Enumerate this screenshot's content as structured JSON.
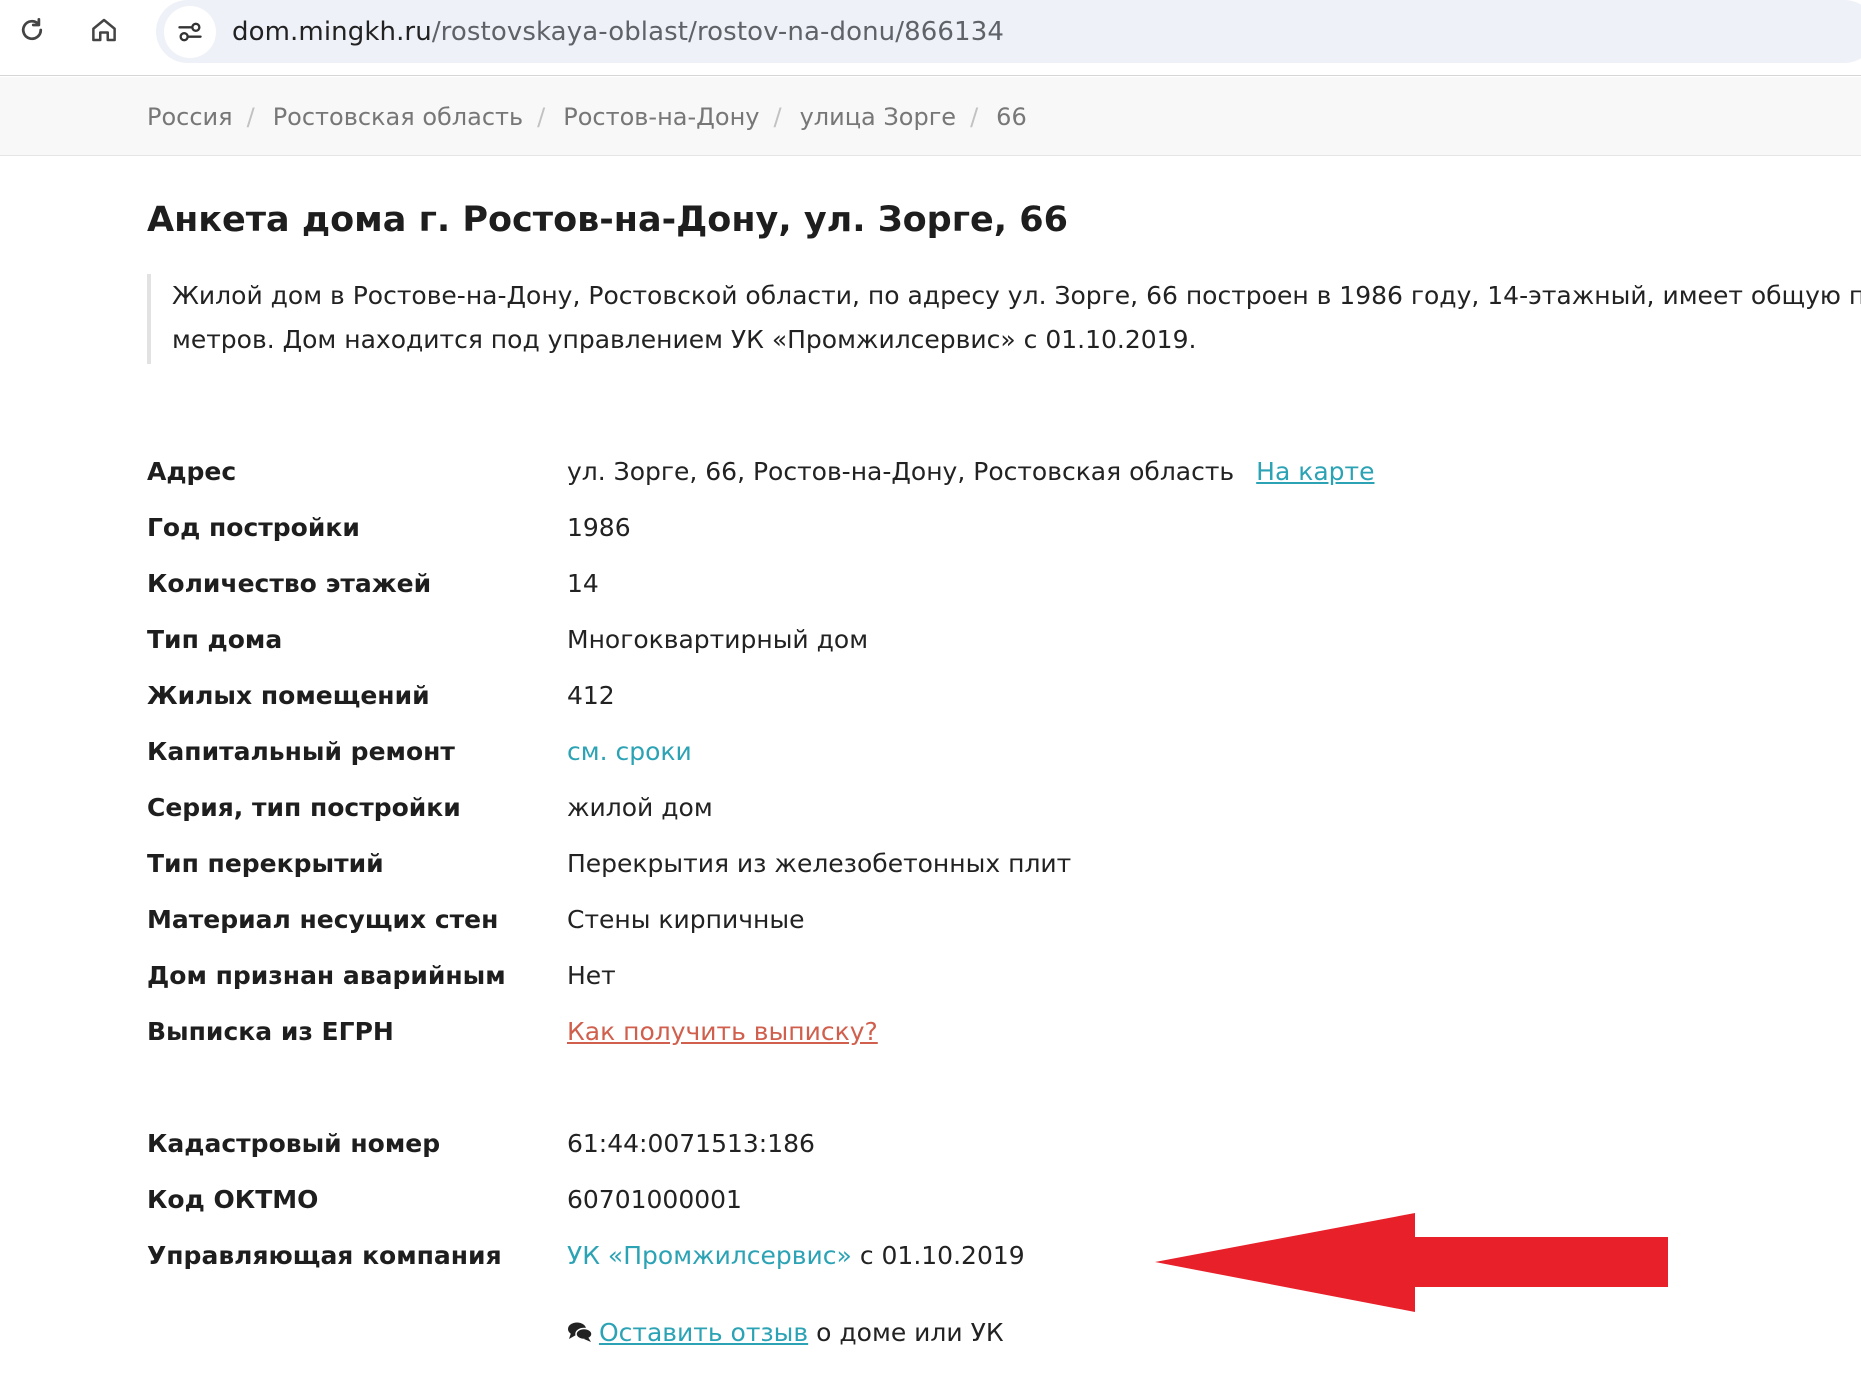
{
  "browser": {
    "url_host": "dom.mingkh.ru",
    "url_path": "/rostovskaya-oblast/rostov-na-donu/866134"
  },
  "breadcrumb": [
    {
      "label": "Россия"
    },
    {
      "label": "Ростовская область"
    },
    {
      "label": "Ростов-на-Дону"
    },
    {
      "label": "улица Зорге"
    },
    {
      "label": "66"
    }
  ],
  "breadcrumb_separator": "/",
  "page": {
    "title": "Анкета дома г. Ростов-на-Дону, ул. Зорге, 66",
    "lead_line1": "Жилой дом в Ростове-на-Дону, Ростовской области, по адресу ул. Зорге, 66 построен в 1986 году, 14-этажный, имеет общую площадь",
    "lead_line2": "метров. Дом находится под управлением УК «Промжилсервис» с 01.10.2019."
  },
  "details": {
    "address": {
      "label": "Адрес",
      "value": "ул. Зорге, 66, Ростов-на-Дону, Ростовская область",
      "map_link": "На карте"
    },
    "year": {
      "label": "Год постройки",
      "value": "1986"
    },
    "floors": {
      "label": "Количество этажей",
      "value": "14"
    },
    "house_type": {
      "label": "Тип дома",
      "value": "Многоквартирный дом"
    },
    "residential": {
      "label": "Жилых помещений",
      "value": "412"
    },
    "capital_repair": {
      "label": "Капитальный ремонт",
      "value": "см. сроки"
    },
    "series": {
      "label": "Серия, тип постройки",
      "value": "жилой дом"
    },
    "floor_type": {
      "label": "Тип перекрытий",
      "value": "Перекрытия из железобетонных плит"
    },
    "wall_material": {
      "label": "Материал несущих стен",
      "value": "Стены кирпичные"
    },
    "emergency": {
      "label": "Дом признан аварийным",
      "value": "Нет"
    },
    "egrn": {
      "label": "Выписка из ЕГРН",
      "value": "Как получить выписку?"
    },
    "cadastral": {
      "label": "Кадастровый номер",
      "value": "61:44:0071513:186"
    },
    "oktmo": {
      "label": "Код ОКТМО",
      "value": "60701000001"
    },
    "management": {
      "label": "Управляющая компания",
      "company": "УК «Промжилсервис»",
      "since": "с 01.10.2019"
    }
  },
  "review": {
    "link": "Оставить отзыв",
    "suffix": "о доме или УК"
  },
  "colors": {
    "link_teal": "#2ca3b5",
    "link_red": "#d0604d",
    "annotation_arrow": "#e8202a"
  },
  "icons": [
    "reload-icon",
    "home-icon",
    "site-info-icon",
    "chat-icon"
  ]
}
